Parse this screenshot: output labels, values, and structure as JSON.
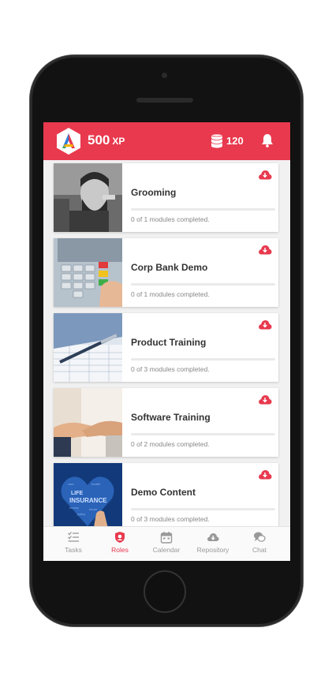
{
  "header": {
    "xp_value": "500",
    "xp_unit": "XP",
    "coins": "120"
  },
  "colors": {
    "accent": "#e8394e"
  },
  "modules": [
    {
      "title": "Grooming",
      "status": "0 of 1 modules completed.",
      "progress": 0,
      "thumb": "barber-photo"
    },
    {
      "title": "Corp Bank Demo",
      "status": "0 of 1 modules completed.",
      "progress": 0,
      "thumb": "atm-keypad-photo"
    },
    {
      "title": "Product Training",
      "status": "0 of 3 modules completed.",
      "progress": 0,
      "thumb": "documents-pen-photo"
    },
    {
      "title": "Software Training",
      "status": "0 of 2 modules completed.",
      "progress": 0,
      "thumb": "handshake-photo"
    },
    {
      "title": "Demo Content",
      "status": "0 of 3 modules completed.",
      "progress": 0,
      "thumb": "life-insurance-wordcloud"
    }
  ],
  "nav": {
    "tasks": "Tasks",
    "roles": "Roles",
    "calendar": "Calendar",
    "repository": "Repository",
    "chat": "Chat",
    "active": "roles"
  }
}
